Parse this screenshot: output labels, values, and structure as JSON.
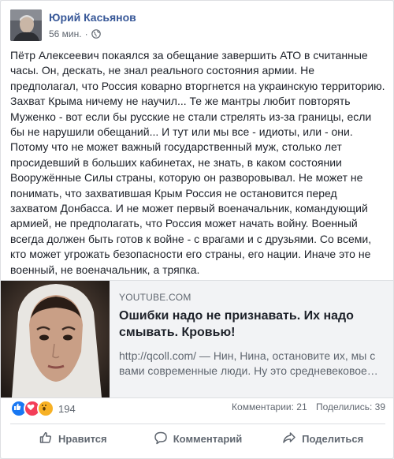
{
  "post": {
    "author": "Юрий Касьянов",
    "time": "56 мин.",
    "separator": "·",
    "privacy_icon": "globe-icon",
    "text": "Пётр Алексеевич покаялся за обещание завершить АТО в считанные часы. Он, дескать, не знал реального состояния армии. Не предполагал, что Россия коварно вторгнется на украинскую территорию. Захват Крыма ничему не научил... Те же мантры любит повторять Муженко - вот если бы русские не стали стрелять из-за границы, если бы не нарушили обещаний... И тут или мы все - идиоты, или - они. Потому что не может важный государственный муж, столько лет просидевший в больших кабинетах, не знать, в каком состоянии Вооружённые Силы страны, которую он разворовывал. Не может не понимать, что захватившая Крым Россия не остановится перед захватом Донбасса. И не может первый военачальник, командующий армией, не предполагать, что Россия может начать войну. Военный всегда должен быть готов к войне - с врагами и с друзьями. Со всеми, кто может угрожать безопасности его страны, его нации. Иначе это не военный, не военачальник, а тряпка."
  },
  "link": {
    "domain": "YOUTUBE.COM",
    "title": "Ошибки надо не признавать. Их надо смывать. Кровью!",
    "description": "http://qcoll.com/ — Нин, Нина, остановите их, мы с вами современные люди. Ну это средневековое…"
  },
  "stats": {
    "reaction_count": "194",
    "comments": "Комментарии: 21",
    "shares": "Поделились: 39",
    "colors": {
      "like": "#1877f2",
      "love": "#f33e58",
      "wow": "#f7b125"
    }
  },
  "actions": {
    "like": "Нравится",
    "comment": "Комментарий",
    "share": "Поделиться"
  }
}
